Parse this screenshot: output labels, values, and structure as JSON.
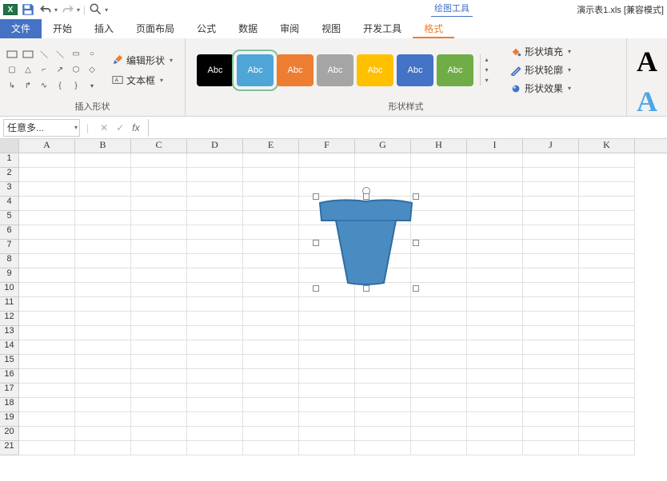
{
  "title": {
    "filename": "演示表1.xls",
    "mode": "[兼容模式]",
    "context_tab": "绘图工具"
  },
  "tabs": {
    "file": "文件",
    "home": "开始",
    "insert": "插入",
    "layout": "页面布局",
    "formulas": "公式",
    "data": "数据",
    "review": "审阅",
    "view": "视图",
    "dev": "开发工具",
    "format": "格式"
  },
  "ribbon": {
    "insert_shapes": {
      "label": "插入形状",
      "edit_shape": "编辑形状",
      "text_box": "文本框"
    },
    "shape_styles": {
      "label": "形状样式",
      "swatch_text": "Abc",
      "swatches": [
        {
          "bg": "#000000"
        },
        {
          "bg": "#4ea5d8",
          "selected": true
        },
        {
          "bg": "#ed7d31"
        },
        {
          "bg": "#a5a5a5"
        },
        {
          "bg": "#ffc000"
        },
        {
          "bg": "#4472c4"
        },
        {
          "bg": "#70ad47"
        }
      ],
      "fill": "形状填充",
      "outline": "形状轮廓",
      "effects": "形状效果"
    }
  },
  "formula_bar": {
    "name_box": "任意多..."
  },
  "grid": {
    "columns": [
      "A",
      "B",
      "C",
      "D",
      "E",
      "F",
      "G",
      "H",
      "I",
      "J",
      "K"
    ],
    "rows": [
      "1",
      "2",
      "3",
      "4",
      "5",
      "6",
      "7",
      "8",
      "9",
      "10",
      "11",
      "12",
      "13",
      "14",
      "15",
      "16",
      "17",
      "18",
      "19",
      "20",
      "21"
    ]
  }
}
